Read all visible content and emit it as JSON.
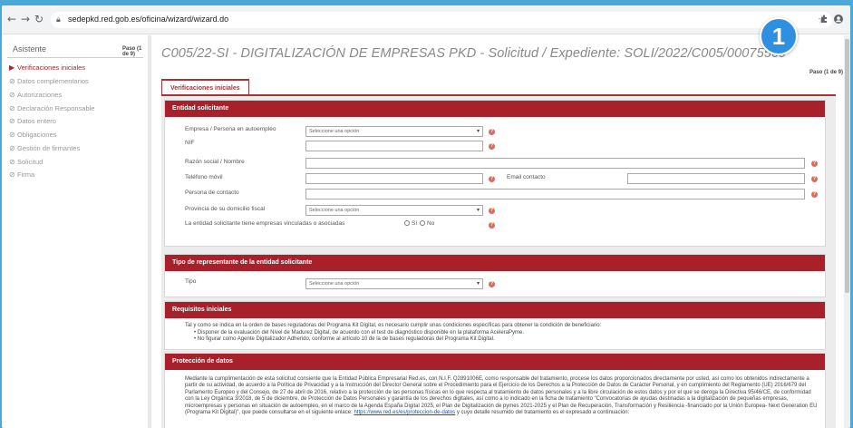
{
  "browser": {
    "url": "sedepkd.red.gob.es/oficina/wizard/wizard.do"
  },
  "step_badge": "1",
  "sidebar": {
    "title": "Asistente",
    "paso": "Paso (1 de 9)",
    "items": [
      {
        "label": "Verificaciones iniciales",
        "active": true,
        "icon": "triangle-right-icon"
      },
      {
        "label": "Datos complementarios",
        "active": false,
        "icon": "check-circle-icon"
      },
      {
        "label": "Autorizaciones",
        "active": false,
        "icon": "check-circle-icon"
      },
      {
        "label": "Declaración Responsable",
        "active": false,
        "icon": "check-circle-icon"
      },
      {
        "label": "Datos entero",
        "active": false,
        "icon": "check-circle-icon"
      },
      {
        "label": "Obligaciones",
        "active": false,
        "icon": "check-circle-icon"
      },
      {
        "label": "Gestión de firmantes",
        "active": false,
        "icon": "check-circle-icon"
      },
      {
        "label": "Solicitud",
        "active": false,
        "icon": "check-circle-icon"
      },
      {
        "label": "Firma",
        "active": false,
        "icon": "check-circle-icon"
      }
    ]
  },
  "main": {
    "title": "C005/22-SI - DIGITALIZACIÓN DE EMPRESAS PKD - Solicitud / Expediente: SOLI/2022/C005/00075569",
    "paso": "Paso (1 de 9)",
    "tab": "Verificaciones iniciales"
  },
  "entidad": {
    "header": "Entidad solicitante",
    "empresa_label": "Empresa / Persona en autoempleo",
    "empresa_select": "Seleccione una opción",
    "nif_label": "NIF",
    "razon_label": "Razón social / Nombre",
    "telefono_label": "Teléfono móvil",
    "email_label": "Email contacto",
    "persona_label": "Persona de contacto",
    "provincia_label": "Provincia de su domicilio fiscal",
    "provincia_select": "Seleccione una opción",
    "vinculadas_label": "La entidad solicitante tiene empresas vinculadas o asociadas",
    "si_label": "Sí",
    "no_label": "No"
  },
  "representante": {
    "header": "Tipo de representante de la entidad solicitante",
    "tipo_label": "Tipo",
    "tipo_select": "Seleccione una opción"
  },
  "requisitos": {
    "header": "Requisitos iniciales",
    "intro": "Tal y como se indica en la orden de bases reguladoras del Programa Kit Digital, es necesario cumplir unas condiciones específicas para obtener la condición de beneficiario:",
    "items": [
      "Disponer de la evaluación del Nivel de Madurez Digital, de acuerdo con el test de diagnóstico disponible en la plataforma AceleraPyme.",
      "No figurar como Agente Digitalizador Adherido, conforme al artículo 10 de la de bases reguladoras del Programa Kit Digital."
    ]
  },
  "proteccion": {
    "header": "Protección de datos",
    "text": "Mediante la cumplimentación de esta solicitud consiente que la Entidad Pública Empresarial Red.es, con N.I.F. Q2891006E, como responsable del tratamiento, procese los datos proporcionados directamente por usted, así como los obtenidos indirectamente a partir de su actividad, de acuerdo a la Política de Privacidad y a la Instrucción del Director General sobre el Procedimiento para el Ejercicio de los Derechos a la Protección de Datos de Carácter Personal, y en cumplimiento del Reglamento (UE) 2016/679 del Parlamento Europeo y del Consejo, de 27 de abril de 2016, relativo a la protección de las personas físicas en lo que respecta al tratamiento de datos personales y a la libre circulación de estos datos y por el que se deroga la Directiva 95/46/CE, de conformidad con la Ley Orgánica 3/2018, de 5 de diciembre, de Protección de Datos Personales y garantía de los derechos digitales, así como a lo indicado en la ficha de tratamiento “Convocatorias de ayudas destinadas a la digitalización de pequeñas empresas, microempresas y personas en situación de autoempleo, en el marco de la Agenda España Digital 2025, el Plan de Digitalización de pymes 2021-2025 y el Plan de Recuperación, Transformación y Resiliencia -financiado por la Unión Europea- Next Generation EU (Programa Kit Digital)”, que puede consultarse en el siguiente enlace:",
    "link": "https://www.red.es/es/proteccion-de-datos",
    "text_after": "y cuyo detalle resumido del tratamiento es el expresado a continuación:"
  }
}
